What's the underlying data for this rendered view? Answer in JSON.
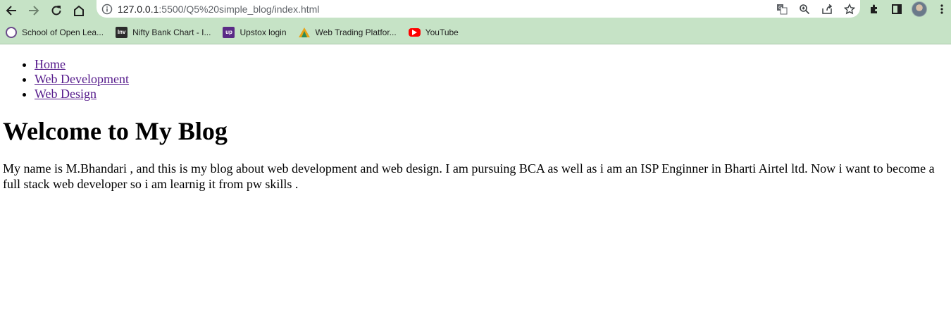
{
  "browser": {
    "url_host": "127.0.0.1",
    "url_rest": ":5500/Q5%20simple_blog/index.html",
    "icons": {
      "back": "back-arrow-icon",
      "forward": "forward-arrow-icon",
      "reload": "reload-icon",
      "home": "home-icon",
      "info": "info-icon",
      "translate": "translate-icon",
      "zoom": "zoom-icon",
      "share": "share-icon",
      "bookmark": "star-icon",
      "extensions": "puzzle-icon",
      "sidepanel": "side-panel-icon",
      "menu": "kebab-menu-icon"
    },
    "toolbar_color": "#c6e3c6"
  },
  "bookmarks": [
    {
      "label": "School of Open Lea...",
      "icon": "school-seal-icon"
    },
    {
      "label": "Nifty Bank Chart - I...",
      "icon": "investing-icon"
    },
    {
      "label": "Upstox login",
      "icon": "upstox-icon"
    },
    {
      "label": "Web Trading Platfor...",
      "icon": "trading-platform-icon"
    },
    {
      "label": "YouTube",
      "icon": "youtube-icon"
    }
  ],
  "nav": {
    "items": [
      {
        "label": "Home"
      },
      {
        "label": "Web Development"
      },
      {
        "label": "Web Design"
      }
    ]
  },
  "main": {
    "title": "Welcome to My Blog",
    "paragraph": "My name is M.Bhandari , and this is my blog about web development and web design. I am pursuing BCA as well as i am an ISP Enginner in Bharti Airtel ltd. Now i want to become a full stack web developer so i am learnig it from pw skills ."
  }
}
